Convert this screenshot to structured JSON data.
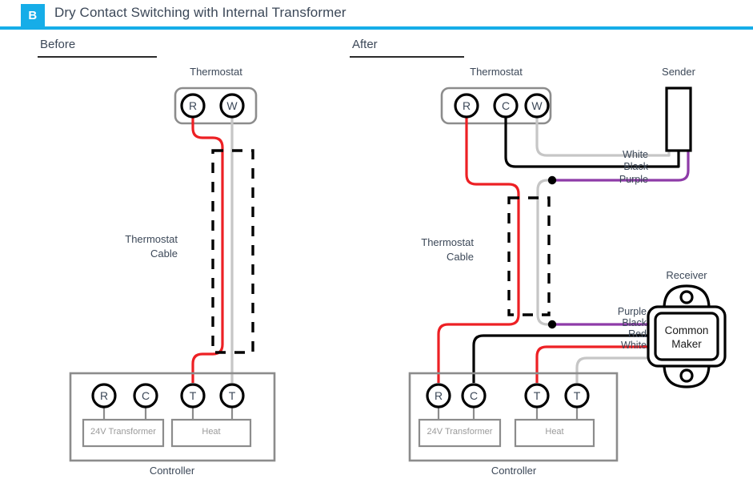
{
  "header": {
    "badge": "B",
    "title": "Dry Contact Switching with Internal Transformer",
    "accent_color": "#16ade8"
  },
  "sections": [
    {
      "id": "before",
      "label": "Before"
    },
    {
      "id": "after",
      "label": "After"
    }
  ],
  "colors": {
    "red": "#ED2024",
    "black": "#000000",
    "purple": "#8E3BA8",
    "white_wire": "#C6C6C6",
    "gray_box": "#8C8C8C",
    "text": "#3c4858",
    "muted": "#9a9a9a"
  },
  "before": {
    "thermostat": {
      "label": "Thermostat",
      "terminals": [
        {
          "name": "R",
          "wire_color": "red"
        },
        {
          "name": "W",
          "wire_color": "white_wire"
        }
      ]
    },
    "cable": {
      "label_line1": "Thermostat",
      "label_line2": "Cable"
    },
    "controller": {
      "label": "Controller",
      "terminals": [
        {
          "name": "R",
          "wire_color": "none"
        },
        {
          "name": "C",
          "wire_color": "none"
        },
        {
          "name": "T",
          "wire_color": "red"
        },
        {
          "name": "T",
          "wire_color": "white_wire"
        }
      ],
      "blocks": [
        {
          "label": "24V Transformer"
        },
        {
          "label": "Heat"
        }
      ]
    }
  },
  "after": {
    "thermostat": {
      "label": "Thermostat",
      "terminals": [
        {
          "name": "R",
          "wire_color": "red"
        },
        {
          "name": "C",
          "wire_color": "black"
        },
        {
          "name": "W",
          "wire_color": "white_wire"
        }
      ]
    },
    "cable": {
      "label_line1": "Thermostat",
      "label_line2": "Cable"
    },
    "sender": {
      "label": "Sender",
      "wire_labels": [
        "White",
        "Black",
        "Purple"
      ]
    },
    "receiver": {
      "label": "Receiver",
      "module_line1": "Common",
      "module_line2": "Maker",
      "wire_labels": [
        "Purple",
        "Black",
        "Red",
        "White"
      ]
    },
    "controller": {
      "label": "Controller",
      "terminals": [
        {
          "name": "R",
          "wire_color": "red"
        },
        {
          "name": "C",
          "wire_color": "black"
        },
        {
          "name": "T",
          "wire_color": "red"
        },
        {
          "name": "T",
          "wire_color": "white_wire"
        }
      ],
      "blocks": [
        {
          "label": "24V Transformer"
        },
        {
          "label": "Heat"
        }
      ]
    }
  }
}
